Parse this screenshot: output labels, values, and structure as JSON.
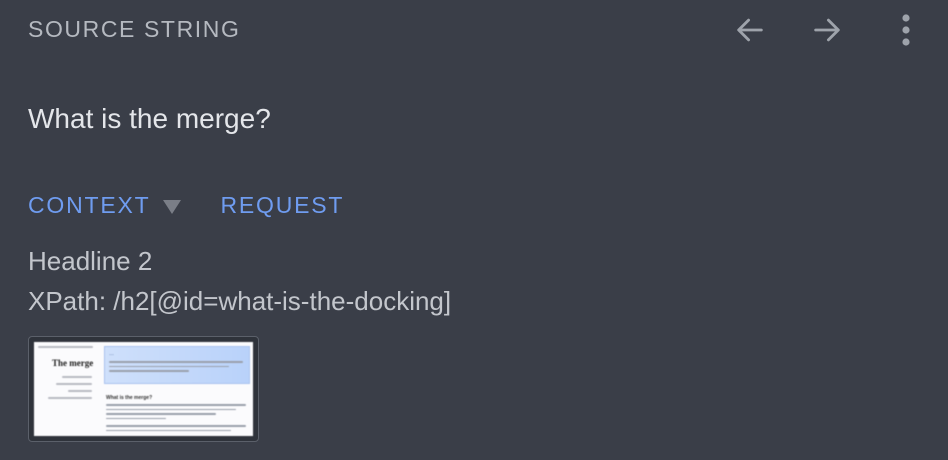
{
  "header": {
    "title": "SOURCE STRING",
    "icons": {
      "prev": "arrow-left-icon",
      "next": "arrow-right-icon",
      "more": "more-vertical-icon"
    },
    "icon_color": "#9ea3ab"
  },
  "source": {
    "text": "What is the merge?"
  },
  "tabs": [
    {
      "label": "CONTEXT",
      "has_dropdown": true
    },
    {
      "label": "REQUEST",
      "has_dropdown": false
    }
  ],
  "context": {
    "element_type": "Headline 2",
    "xpath": "XPath: /h2[@id=what-is-the-docking]"
  },
  "thumbnail": {
    "heading": "The merge",
    "banner_title": "…",
    "subheading": "What is the merge?"
  },
  "colors": {
    "background": "#3a3e48",
    "accent": "#6f9cf0",
    "text_primary": "#e4e6ea",
    "text_secondary": "#b5b9c0"
  }
}
